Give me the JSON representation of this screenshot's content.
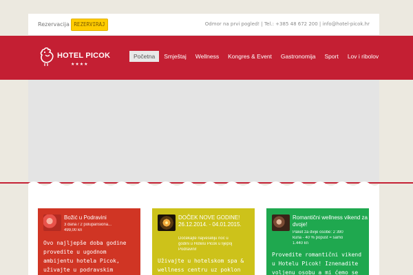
{
  "topbar": {
    "reservation_link": "Rezervacija",
    "reserve_button": "REZERVIRAJ",
    "contact": "Odmor na prvi pogled! | Tel.: +385 48 672 200 | info@hotel-picok.hr"
  },
  "brand": {
    "name": "HOTEL PICOK",
    "stars": "★★★★"
  },
  "nav": {
    "items": [
      "Početna",
      "Smještaj",
      "Wellness",
      "Kongres & Event",
      "Gastronomija",
      "Sport",
      "Lov i ribolov"
    ]
  },
  "cards": [
    {
      "title": "Božić u Podravini",
      "meta": [
        "3 dana / 2 polupansiona...",
        "499,00 kn"
      ],
      "desc": "Ovo najljepše doba godine provedite u ugodnom ambijentu hotela Picok, uživajte u podravskim"
    },
    {
      "title": "DOČEK NOVE GODINE! 26.12.2014. - 04.01.2015.",
      "meta": [
        "Dočekajte najveseliju noć u",
        "godini u Hotelu Picok u lijepoj",
        "Podravini!"
      ],
      "desc": "Uživajte u hotelskom spa & wellness centru uz poklon"
    },
    {
      "title": "Romantični wellness vikend za dvoje!",
      "meta": [
        "Paket za dvije osobe: 2 390",
        "kuna - 40 % popust = samo",
        "1.440 kn"
      ],
      "desc": "Provedite romantični vikend u Hotelu Picok! Iznenadite voljenu osobu a mi ćemo se"
    }
  ],
  "colors": {
    "header": "#c41f33",
    "reserve_button": "#ffcc00",
    "card_red": "#d03524",
    "card_yellow": "#cdc21a",
    "card_green": "#1fa84f"
  }
}
